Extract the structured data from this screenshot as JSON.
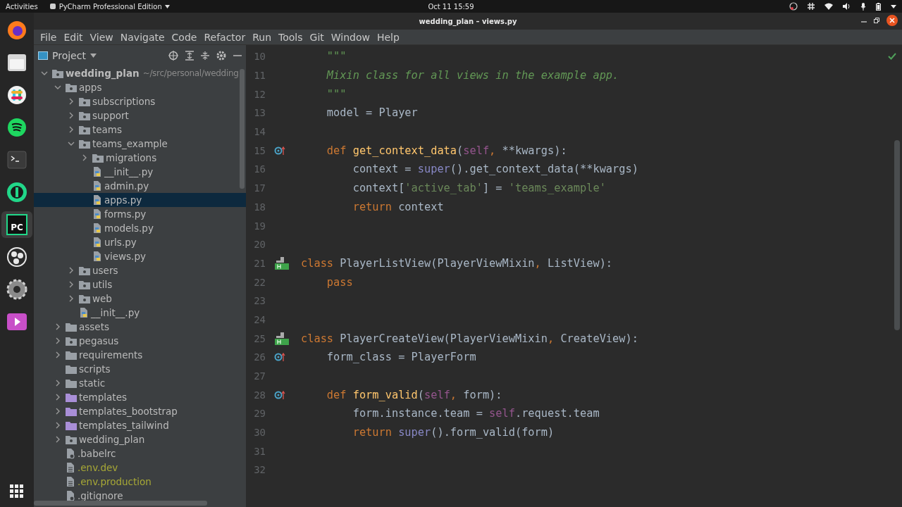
{
  "top_bar": {
    "activities": "Activities",
    "app_menu": "PyCharm Professional Edition",
    "clock": "Oct 11  15:59"
  },
  "dock": [
    {
      "kind": "firefox"
    },
    {
      "kind": "files"
    },
    {
      "kind": "slack"
    },
    {
      "kind": "spotify"
    },
    {
      "kind": "terminal"
    },
    {
      "kind": "pycharm-ce"
    },
    {
      "kind": "pycharm",
      "label": "PC",
      "selected": true
    },
    {
      "kind": "obs"
    },
    {
      "kind": "settings"
    },
    {
      "kind": "media"
    }
  ],
  "window": {
    "title": "wedding_plan – views.py"
  },
  "menu": [
    "File",
    "Edit",
    "View",
    "Navigate",
    "Code",
    "Refactor",
    "Run",
    "Tools",
    "Git",
    "Window",
    "Help"
  ],
  "project_panel": {
    "title": "Project",
    "tree": [
      {
        "label": "wedding_plan",
        "hint": "~/src/personal/wedding",
        "kind": "root",
        "expanded": true,
        "selected": false,
        "children": [
          {
            "label": "apps",
            "kind": "package",
            "expanded": true,
            "selected": false,
            "children": [
              {
                "label": "subscriptions",
                "kind": "package",
                "expanded": false,
                "selected": false
              },
              {
                "label": "support",
                "kind": "package",
                "expanded": false,
                "selected": false
              },
              {
                "label": "teams",
                "kind": "package",
                "expanded": false,
                "selected": false
              },
              {
                "label": "teams_example",
                "kind": "package",
                "expanded": true,
                "selected": false,
                "children": [
                  {
                    "label": "migrations",
                    "kind": "package",
                    "expanded": false,
                    "selected": false
                  },
                  {
                    "label": "__init__.py",
                    "kind": "python",
                    "selected": false
                  },
                  {
                    "label": "admin.py",
                    "kind": "python",
                    "selected": false
                  },
                  {
                    "label": "apps.py",
                    "kind": "python",
                    "selected": true
                  },
                  {
                    "label": "forms.py",
                    "kind": "python",
                    "selected": false
                  },
                  {
                    "label": "models.py",
                    "kind": "python",
                    "selected": false
                  },
                  {
                    "label": "urls.py",
                    "kind": "python",
                    "selected": false
                  },
                  {
                    "label": "views.py",
                    "kind": "python",
                    "selected": false
                  }
                ]
              },
              {
                "label": "users",
                "kind": "package",
                "expanded": false,
                "selected": false
              },
              {
                "label": "utils",
                "kind": "package",
                "expanded": false,
                "selected": false
              },
              {
                "label": "web",
                "kind": "package",
                "expanded": false,
                "selected": false
              },
              {
                "label": "__init__.py",
                "kind": "python",
                "selected": false
              }
            ]
          },
          {
            "label": "assets",
            "kind": "folder",
            "expanded": false,
            "selected": false
          },
          {
            "label": "pegasus",
            "kind": "package",
            "expanded": false,
            "selected": false
          },
          {
            "label": "requirements",
            "kind": "folder",
            "expanded": false,
            "selected": false
          },
          {
            "label": "scripts",
            "kind": "folder",
            "selected": false
          },
          {
            "label": "static",
            "kind": "folder",
            "expanded": false,
            "selected": false
          },
          {
            "label": "templates",
            "kind": "templates",
            "expanded": false,
            "selected": false
          },
          {
            "label": "templates_bootstrap",
            "kind": "templates",
            "expanded": false,
            "selected": false
          },
          {
            "label": "templates_tailwind",
            "kind": "templates",
            "expanded": false,
            "selected": false
          },
          {
            "label": "wedding_plan",
            "kind": "package",
            "expanded": false,
            "selected": false
          },
          {
            "label": ".babelrc",
            "kind": "config",
            "selected": false
          },
          {
            "label": ".env.dev",
            "kind": "ignored",
            "selected": false
          },
          {
            "label": ".env.production",
            "kind": "ignored",
            "selected": false
          },
          {
            "label": ".gitignore",
            "kind": "config",
            "selected": false
          }
        ]
      }
    ]
  },
  "editor": {
    "lines": [
      {
        "number": "10",
        "kind": "plain",
        "tokens": [
          {
            "kind": "doc",
            "text": "    \"\"\""
          }
        ]
      },
      {
        "number": "11",
        "kind": "plain",
        "tokens": [
          {
            "kind": "doc",
            "text": "    Mixin class for all views in the example app."
          }
        ]
      },
      {
        "number": "12",
        "kind": "plain",
        "tokens": [
          {
            "kind": "doc",
            "text": "    \"\"\""
          }
        ]
      },
      {
        "number": "13",
        "kind": "plain",
        "tokens": [
          {
            "kind": "plain",
            "text": "    model = Player"
          }
        ]
      },
      {
        "number": "14",
        "kind": "plain"
      },
      {
        "number": "15",
        "kind": "override",
        "tokens": [
          {
            "kind": "keyword",
            "text": "    def "
          },
          {
            "kind": "function",
            "text": "get_context_data"
          },
          {
            "kind": "plain",
            "text": "("
          },
          {
            "kind": "self",
            "text": "self"
          },
          {
            "kind": "keyword",
            "text": ", "
          },
          {
            "kind": "plain",
            "text": "**kwargs):"
          }
        ]
      },
      {
        "number": "16",
        "kind": "plain",
        "tokens": [
          {
            "kind": "plain",
            "text": "        context = "
          },
          {
            "kind": "builtin",
            "text": "super"
          },
          {
            "kind": "plain",
            "text": "().get_context_data(**kwargs)"
          }
        ]
      },
      {
        "number": "17",
        "kind": "plain",
        "tokens": [
          {
            "kind": "plain",
            "text": "        context["
          },
          {
            "kind": "string",
            "text": "'active_tab'"
          },
          {
            "kind": "plain",
            "text": "] = "
          },
          {
            "kind": "string",
            "text": "'teams_example'"
          }
        ]
      },
      {
        "number": "18",
        "kind": "plain",
        "tokens": [
          {
            "kind": "keyword",
            "text": "        return "
          },
          {
            "kind": "plain",
            "text": "context"
          }
        ]
      },
      {
        "number": "19",
        "kind": "plain"
      },
      {
        "number": "20",
        "kind": "plain"
      },
      {
        "number": "21",
        "kind": "implemented",
        "tokens": [
          {
            "kind": "keyword",
            "text": "class "
          },
          {
            "kind": "plain",
            "text": "PlayerListView(PlayerViewMixin"
          },
          {
            "kind": "keyword",
            "text": ", "
          },
          {
            "kind": "plain",
            "text": "ListView):"
          }
        ]
      },
      {
        "number": "22",
        "kind": "plain",
        "tokens": [
          {
            "kind": "keyword",
            "text": "    pass"
          }
        ]
      },
      {
        "number": "23",
        "kind": "plain"
      },
      {
        "number": "24",
        "kind": "plain"
      },
      {
        "number": "25",
        "kind": "implemented",
        "tokens": [
          {
            "kind": "keyword",
            "text": "class "
          },
          {
            "kind": "plain",
            "text": "PlayerCreateView(PlayerViewMixin"
          },
          {
            "kind": "keyword",
            "text": ", "
          },
          {
            "kind": "plain",
            "text": "CreateView):"
          }
        ]
      },
      {
        "number": "26",
        "kind": "override",
        "tokens": [
          {
            "kind": "plain",
            "text": "    form_class = PlayerForm"
          }
        ]
      },
      {
        "number": "27",
        "kind": "plain"
      },
      {
        "number": "28",
        "kind": "override",
        "tokens": [
          {
            "kind": "keyword",
            "text": "    def "
          },
          {
            "kind": "function",
            "text": "form_valid"
          },
          {
            "kind": "plain",
            "text": "("
          },
          {
            "kind": "self",
            "text": "self"
          },
          {
            "kind": "keyword",
            "text": ", "
          },
          {
            "kind": "plain",
            "text": "form):"
          }
        ]
      },
      {
        "number": "29",
        "kind": "plain",
        "tokens": [
          {
            "kind": "plain",
            "text": "        form.instance.team = "
          },
          {
            "kind": "self",
            "text": "self"
          },
          {
            "kind": "plain",
            "text": ".request.team"
          }
        ]
      },
      {
        "number": "30",
        "kind": "plain",
        "tokens": [
          {
            "kind": "keyword",
            "text": "        return "
          },
          {
            "kind": "builtin",
            "text": "super"
          },
          {
            "kind": "plain",
            "text": "().form_valid(form)"
          }
        ]
      },
      {
        "number": "31",
        "kind": "plain"
      },
      {
        "number": "32",
        "kind": "plain"
      }
    ]
  }
}
